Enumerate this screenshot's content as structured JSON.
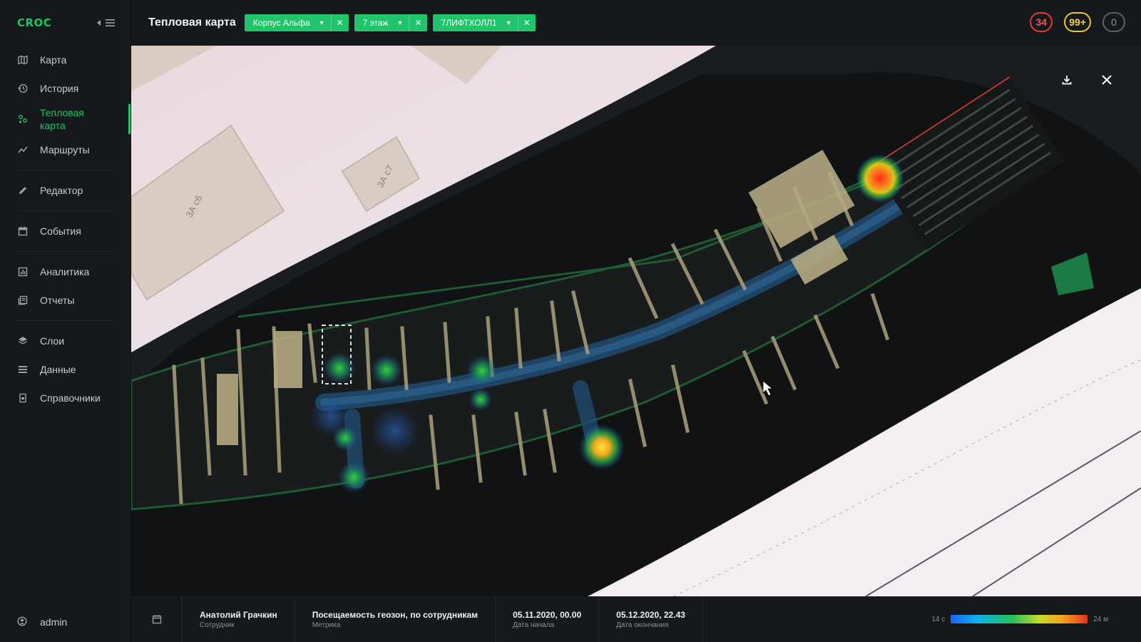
{
  "app": {
    "logo": "CROC"
  },
  "sidebar": {
    "items": [
      {
        "label": "Карта",
        "icon": "map-icon"
      },
      {
        "label": "История",
        "icon": "history-icon"
      },
      {
        "label": "Тепловая карта",
        "icon": "heatmap-icon",
        "active": true
      },
      {
        "label": "Маршруты",
        "icon": "routes-icon"
      },
      {
        "label": "Редактор",
        "icon": "pencil-icon"
      },
      {
        "label": "События",
        "icon": "calendar-icon"
      },
      {
        "label": "Аналитика",
        "icon": "analytics-icon"
      },
      {
        "label": "Отчеты",
        "icon": "reports-icon"
      },
      {
        "label": "Слои",
        "icon": "layers-icon"
      },
      {
        "label": "Данные",
        "icon": "list-icon"
      },
      {
        "label": "Справочники",
        "icon": "handbook-icon"
      }
    ],
    "user": "admin"
  },
  "header": {
    "title": "Тепловая карта",
    "filters": [
      {
        "label": "Корпус Альфа"
      },
      {
        "label": "7 этаж"
      },
      {
        "label": "7ЛИФТХОЛЛ1"
      }
    ],
    "badges": {
      "red": "34",
      "yellow": "99+",
      "gray": "0"
    }
  },
  "map": {
    "labels": {
      "building_a": "3А с6",
      "building_b": "3А с7"
    }
  },
  "footer": {
    "employee": {
      "value": "Анатолий Грачкин",
      "label": "Сотрудник"
    },
    "metric": {
      "value": "Посещаемость геозон, по сотрудникам",
      "label": "Метрика"
    },
    "start": {
      "value": "05.11.2020, 00.00",
      "label": "Дата начала"
    },
    "end": {
      "value": "05.12.2020, 22.43",
      "label": "Дата окончания"
    },
    "legend": {
      "min": "14 с",
      "max": "24 м"
    }
  },
  "colors": {
    "accent": "#1fc46b",
    "alert": "#e53935",
    "warning": "#f2c12e"
  }
}
